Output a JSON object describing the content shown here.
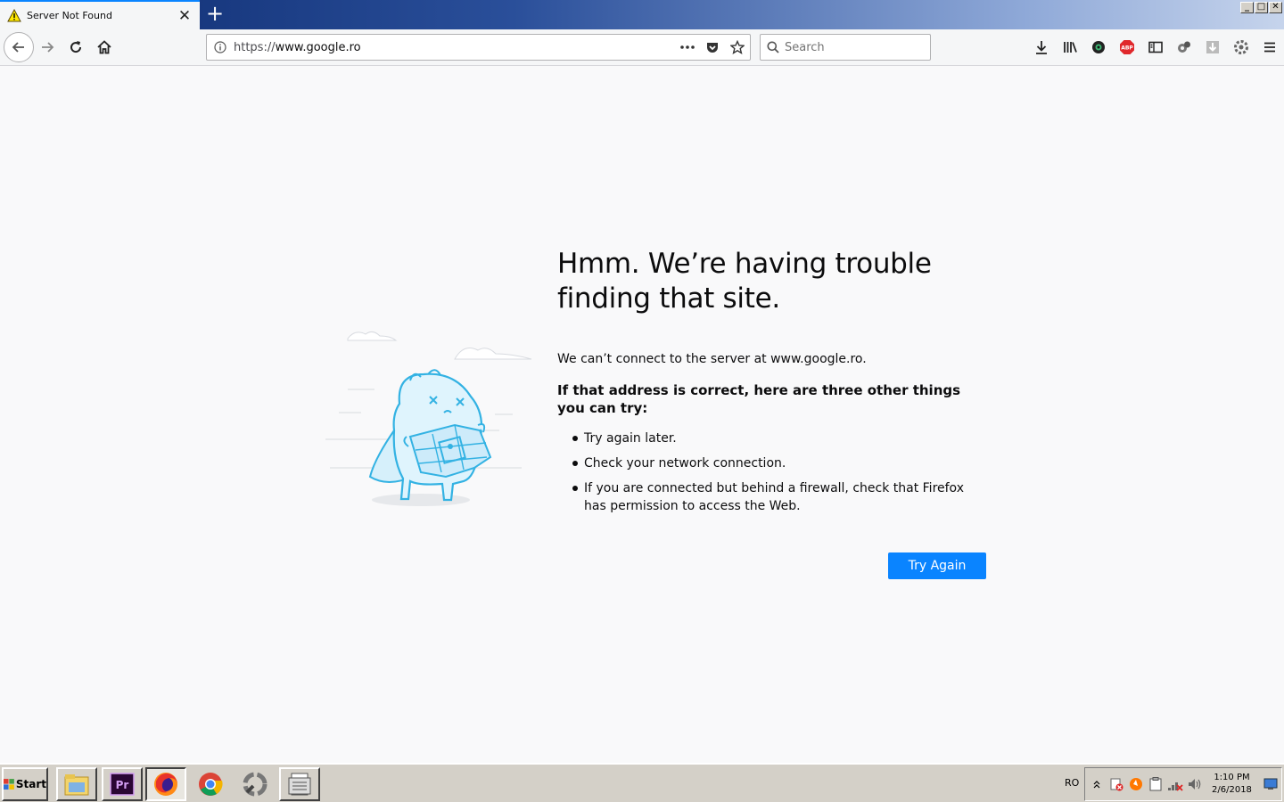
{
  "tab": {
    "title": "Server Not Found",
    "close": "✕"
  },
  "newtab": {
    "label": "+"
  },
  "window_buttons": {
    "minimize": "_",
    "maximize": "□",
    "close": "✕"
  },
  "urlbar": {
    "scheme": "https://",
    "host": "www.google.ro"
  },
  "search": {
    "placeholder": "Search"
  },
  "error": {
    "title_line1": "Hmm. We’re having trouble",
    "title_line2": "finding that site.",
    "description": "We can’t connect to the server at www.google.ro.",
    "suggest_heading": "If that address is correct, here are three other things you can try:",
    "suggestions": [
      "Try again later.",
      "Check your network connection.",
      "If you are connected but behind a firewall, check that Firefox has permission to access the Web."
    ],
    "button": "Try Again"
  },
  "taskbar": {
    "start": "Start",
    "language": "RO",
    "time": "1:10 PM",
    "date": "2/6/2018",
    "apps": [
      "file-explorer-icon",
      "premiere-icon",
      "firefox-icon",
      "chrome-icon",
      "app-icon",
      "documents-icon"
    ]
  },
  "colors": {
    "accent": "#0a84ff",
    "background": "#f9f9fa",
    "text": "#0c0c0d"
  }
}
